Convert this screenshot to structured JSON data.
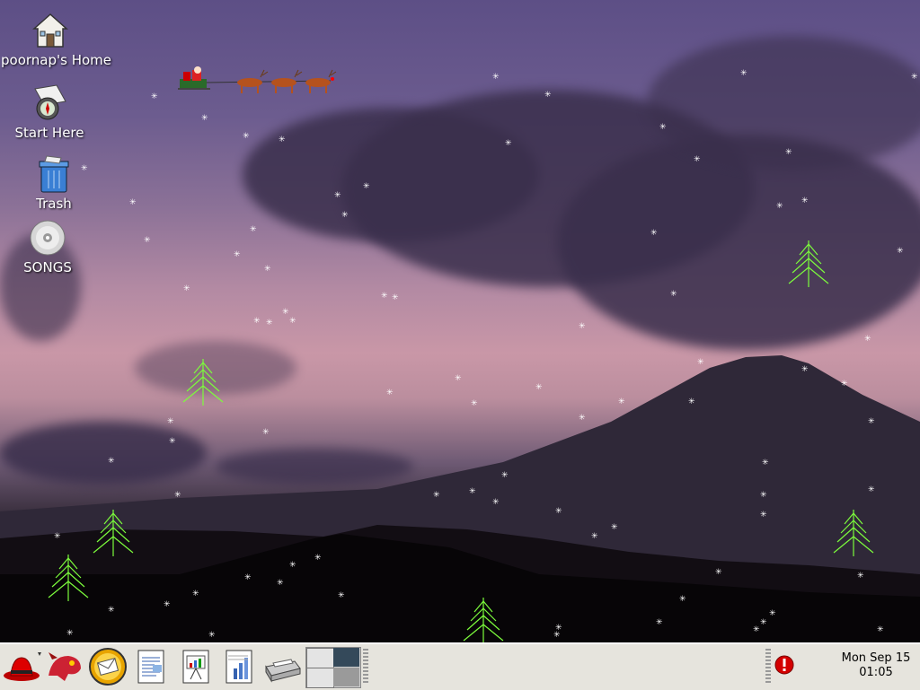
{
  "desktop": {
    "icons": [
      {
        "label": "poornap's Home",
        "icon": "home-folder-icon"
      },
      {
        "label": "Start Here",
        "icon": "compass-map-icon"
      },
      {
        "label": "Trash",
        "icon": "trash-icon"
      },
      {
        "label": "SONGS",
        "icon": "cd-disc-icon"
      }
    ]
  },
  "panel": {
    "launchers": [
      {
        "name": "main-menu",
        "icon": "redhat-hat-icon"
      },
      {
        "name": "web-browser",
        "icon": "mozilla-dragon-icon"
      },
      {
        "name": "email",
        "icon": "evolution-mail-icon"
      },
      {
        "name": "writer",
        "icon": "writer-document-icon"
      },
      {
        "name": "impress",
        "icon": "impress-presentation-icon"
      },
      {
        "name": "calc",
        "icon": "calc-spreadsheet-icon"
      },
      {
        "name": "print-manager",
        "icon": "printer-icon"
      }
    ],
    "workspace_switcher": {
      "workspaces": 4,
      "active": 1
    },
    "notification": {
      "icon": "error-alert-icon",
      "color": "#d40000"
    },
    "clock": {
      "date": "Mon Sep 15",
      "time": "01:05"
    }
  },
  "colors": {
    "tree": "#7cfc3c",
    "panel_bg": "#e6e4dd",
    "snow": "#ffffff"
  }
}
